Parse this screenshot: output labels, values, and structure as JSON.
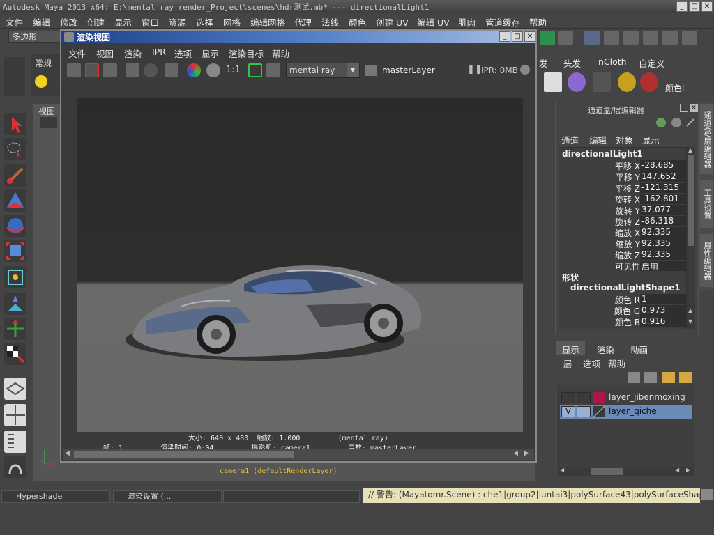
{
  "window": {
    "title": "Autodesk Maya 2013 x64: E:\\mental ray render_Project\\scenes\\hdr测试.mb*   ---   directionalLight1",
    "minimize": "_",
    "maximize": "□",
    "close": "✕"
  },
  "menubar": {
    "items": [
      "文件",
      "编辑",
      "修改",
      "创建",
      "显示",
      "窗口",
      "资源",
      "选择",
      "网格",
      "编辑网格",
      "代理",
      "法线",
      "颜色",
      "创建 UV",
      "编辑 UV",
      "肌肉",
      "管道缓存",
      "帮助"
    ]
  },
  "toolbar": {
    "mode": "多边形"
  },
  "shelf": {
    "tab_label": "常规",
    "right_tabs": [
      "发",
      "头发",
      "nCloth",
      "自定义"
    ],
    "color_label": "颜色i"
  },
  "viewport": {
    "menu_label": "视图",
    "camera_label": "camera1 (defaultRenderLayer)"
  },
  "render_view": {
    "title": "渲染视图",
    "menu": [
      "文件",
      "视图",
      "渲染",
      "IPR",
      "选项",
      "显示",
      "渲染目标",
      "帮助"
    ],
    "ratio_label": "1:1",
    "renderer": "mental ray",
    "layer": "masterLayer",
    "ipr_status": "IPR: 0MB",
    "info_line1": "大小: 640 x 480  缩放: 1.000         (mental ray)",
    "info_line2": "帧: 1         渲染时间: 0:04         摄影机: camera1         层数: masterLayer"
  },
  "channel_box": {
    "title": "通道盒/层编辑器",
    "menu": [
      "通道",
      "编辑",
      "对象",
      "显示"
    ],
    "node": "directionalLight1",
    "attributes": [
      {
        "label": "平移 X",
        "value": "-28.685"
      },
      {
        "label": "平移 Y",
        "value": "147.652"
      },
      {
        "label": "平移 Z",
        "value": "-121.315"
      },
      {
        "label": "旋转 X",
        "value": "-162.801"
      },
      {
        "label": "旋转 Y",
        "value": "37.077"
      },
      {
        "label": "旋转 Z",
        "value": "-86.318"
      },
      {
        "label": "缩放 X",
        "value": "92.335"
      },
      {
        "label": "缩放 Y",
        "value": "92.335"
      },
      {
        "label": "缩放 Z",
        "value": "92.335"
      },
      {
        "label": "可见性",
        "value": "启用"
      }
    ],
    "shapes_header": "形状",
    "shape_node": "directionalLightShape1",
    "shape_attributes": [
      {
        "label": "颜色 R",
        "value": "1"
      },
      {
        "label": "颜色 G",
        "value": "0.973"
      },
      {
        "label": "颜色 B",
        "value": "0.916"
      }
    ]
  },
  "side_tabs": [
    "通道盒/层编辑器",
    "工具设置",
    "属性编辑器"
  ],
  "layer_editor": {
    "tabs": [
      "显示",
      "渲染",
      "动画"
    ],
    "menu": [
      "层",
      "选项",
      "帮助"
    ],
    "layers": [
      {
        "name": "layer_jibenmoxing",
        "visible": "",
        "color": "#b0164a"
      },
      {
        "name": "layer_qiche",
        "visible": "V",
        "color": "#3a3a3a"
      }
    ]
  },
  "taskbar": {
    "items": [
      "Hypershade",
      "渲染设置 (..."
    ]
  },
  "command_line": "// 警告: (Mayatomr.Scene) : che1|group2|luntai3|polySurface43|polySurfaceShape43:"
}
